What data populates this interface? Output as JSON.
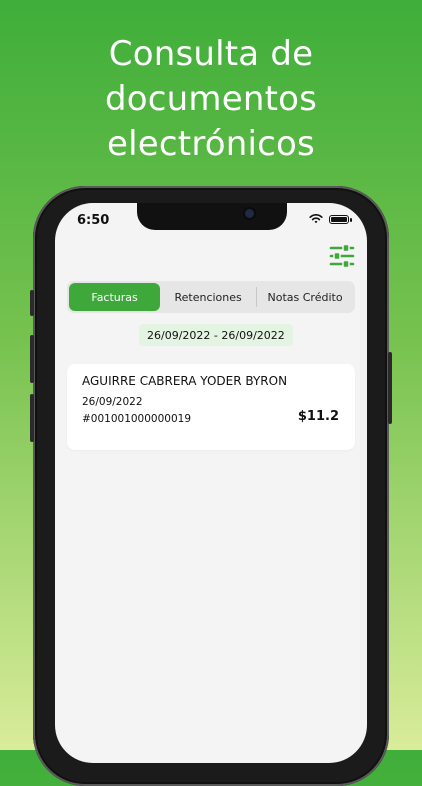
{
  "headline": {
    "line1": "Consulta de",
    "line2": "documentos",
    "line3": "electrónicos"
  },
  "status_bar": {
    "time": "6:50",
    "icons": [
      "wifi-icon",
      "battery-icon"
    ]
  },
  "toolbar": {
    "filter_icon": "sliders-icon"
  },
  "tabs": [
    {
      "label": "Facturas",
      "active": true
    },
    {
      "label": "Retenciones",
      "active": false
    },
    {
      "label": "Notas Crédito",
      "active": false
    }
  ],
  "date_range": "26/09/2022 - 26/09/2022",
  "documents": [
    {
      "name": "AGUIRRE CABRERA YODER BYRON",
      "date": "26/09/2022",
      "number": "#001001000000019",
      "amount": "$11.2"
    }
  ],
  "colors": {
    "accent": "#3ea83a",
    "date_chip": "#e4f4e2",
    "gradient_top": "#3fae3a",
    "gradient_bottom": "#d9ec9a"
  }
}
